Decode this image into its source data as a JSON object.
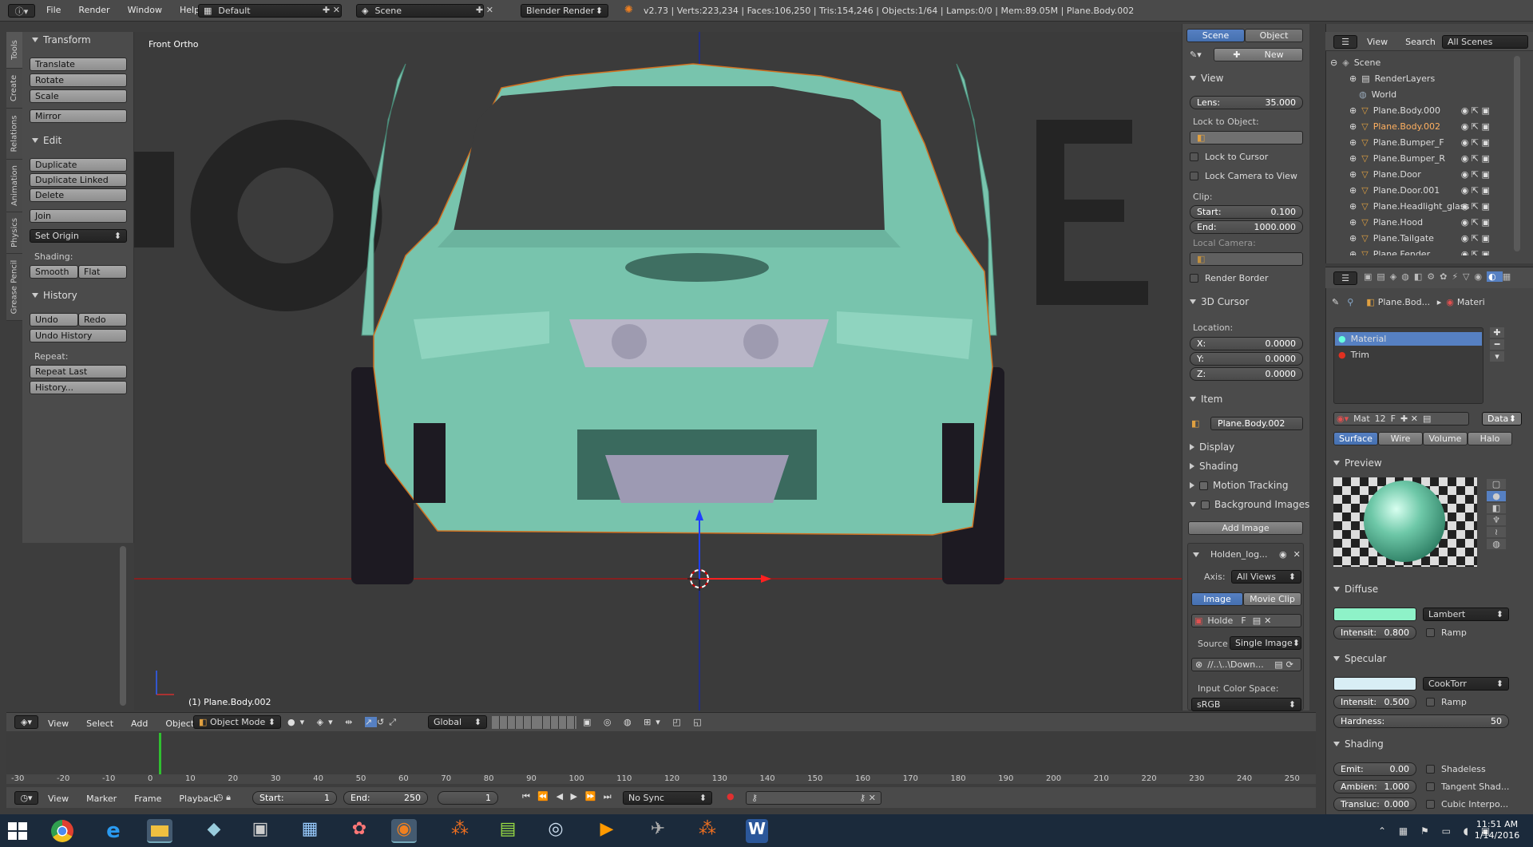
{
  "topbar": {
    "menus": [
      "File",
      "Render",
      "Window",
      "Help"
    ],
    "layout": "Default",
    "scene": "Scene",
    "engine": "Blender Render",
    "stats": "v2.73 | Verts:223,234 | Faces:106,250 | Tris:154,246 | Objects:1/64 | Lamps:0/0 | Mem:89.05M | Plane.Body.002"
  },
  "viewport": {
    "label": "Front Ortho",
    "object_label": "(1) Plane.Body.002"
  },
  "tool_tabs": [
    "Tools",
    "Create",
    "Relations",
    "Animation",
    "Physics",
    "Grease Pencil"
  ],
  "tools": {
    "transform": {
      "title": "Transform",
      "buttons": [
        "Translate",
        "Rotate",
        "Scale"
      ],
      "mirror": "Mirror"
    },
    "edit": {
      "title": "Edit",
      "buttons": [
        "Duplicate",
        "Duplicate Linked",
        "Delete"
      ],
      "join": "Join",
      "set_origin": "Set Origin",
      "shading_label": "Shading:",
      "smooth": "Smooth",
      "flat": "Flat"
    },
    "history": {
      "title": "History",
      "undo": "Undo",
      "redo": "Redo",
      "undo_history": "Undo History",
      "repeat_label": "Repeat:",
      "repeat_last": "Repeat Last",
      "history": "History..."
    }
  },
  "props": {
    "tabs": [
      "Scene",
      "Object"
    ],
    "new": "New",
    "view": {
      "title": "View",
      "lens_label": "Lens:",
      "lens": "35.000",
      "lock_object": "Lock to Object:",
      "lock_cursor": "Lock to Cursor",
      "lock_camera": "Lock Camera to View",
      "clip": "Clip:",
      "start_label": "Start:",
      "start": "0.100",
      "end_label": "End:",
      "end": "1000.000",
      "local_camera": "Local Camera:",
      "render_border": "Render Border"
    },
    "cursor": {
      "title": "3D Cursor",
      "location": "Location:",
      "x_label": "X:",
      "x": "0.0000",
      "y_label": "Y:",
      "y": "0.0000",
      "z_label": "Z:",
      "z": "0.0000"
    },
    "item": {
      "title": "Item",
      "name": "Plane.Body.002"
    },
    "collapsed": [
      "Display",
      "Shading"
    ],
    "motion_tracking": "Motion Tracking",
    "background_images": "Background Images",
    "add_image": "Add Image",
    "bg": {
      "name": "Holden_log...",
      "axis_label": "Axis:",
      "axis": "All Views",
      "image": "Image",
      "movie_clip": "Movie Clip",
      "img_name": "Holde",
      "f": "F",
      "source_label": "Source",
      "source": "Single Image",
      "path": "//..\\..\\Down...",
      "color_space_label": "Input Color Space:",
      "color_space": "sRGB"
    }
  },
  "outliner": {
    "menus": [
      "View",
      "Search"
    ],
    "filter": "All Scenes",
    "scene": "Scene",
    "items": [
      "RenderLayers",
      "World",
      "Plane.Body.000",
      "Plane.Body.002",
      "Plane.Bumper_F",
      "Plane.Bumper_R",
      "Plane.Door",
      "Plane.Door.001",
      "Plane.Headlight_glass",
      "Plane.Hood",
      "Plane.Tailgate",
      "Plane.Fender"
    ]
  },
  "material": {
    "breadcrumb_obj": "Plane.Bod...",
    "breadcrumb_mat": "Materi",
    "slots": [
      "Material",
      "Trim"
    ],
    "mat_name": "Mat",
    "users": "12",
    "f": "F",
    "data": "Data",
    "tabs": [
      "Surface",
      "Wire",
      "Volume",
      "Halo"
    ],
    "preview": "Preview",
    "diffuse": {
      "title": "Diffuse",
      "shader": "Lambert",
      "intensity_label": "Intensit:",
      "intensity": "0.800",
      "ramp": "Ramp",
      "color": "#8ef2c8"
    },
    "specular": {
      "title": "Specular",
      "shader": "CookTorr",
      "intensity_label": "Intensit:",
      "intensity": "0.500",
      "ramp": "Ramp",
      "color": "#d8eef5"
    },
    "hardness_label": "Hardness:",
    "hardness": "50",
    "shading": {
      "title": "Shading",
      "emit_label": "Emit:",
      "emit": "0.00",
      "ambient_label": "Ambien:",
      "ambient": "1.000",
      "translucency_label": "Transluc:",
      "translucency": "0.000",
      "shadeless": "Shadeless",
      "tangent": "Tangent Shad...",
      "cubic": "Cubic Interpo..."
    }
  },
  "header3d": {
    "menus": [
      "View",
      "Select",
      "Add",
      "Object"
    ],
    "mode": "Object Mode",
    "orientation": "Global"
  },
  "timeline": {
    "ticks": [
      "-30",
      "-20",
      "-10",
      "0",
      "10",
      "20",
      "30",
      "40",
      "50",
      "60",
      "70",
      "80",
      "90",
      "100",
      "110",
      "120",
      "130",
      "140",
      "150",
      "160",
      "170",
      "180",
      "190",
      "200",
      "210",
      "220",
      "230",
      "240",
      "250"
    ],
    "menus": [
      "View",
      "Marker",
      "Frame",
      "Playback"
    ],
    "start_label": "Start:",
    "start": "1",
    "end_label": "End:",
    "end": "250",
    "current": "1",
    "sync": "No Sync"
  },
  "taskbar": {
    "time": "11:51 AM",
    "date": "1/14/2016"
  },
  "colors": {
    "car": "#78c4ad",
    "bg_logo": "#222222",
    "axis_red": "#c02020",
    "axis_blue": "#2040c0",
    "selection": "#5680c2"
  }
}
